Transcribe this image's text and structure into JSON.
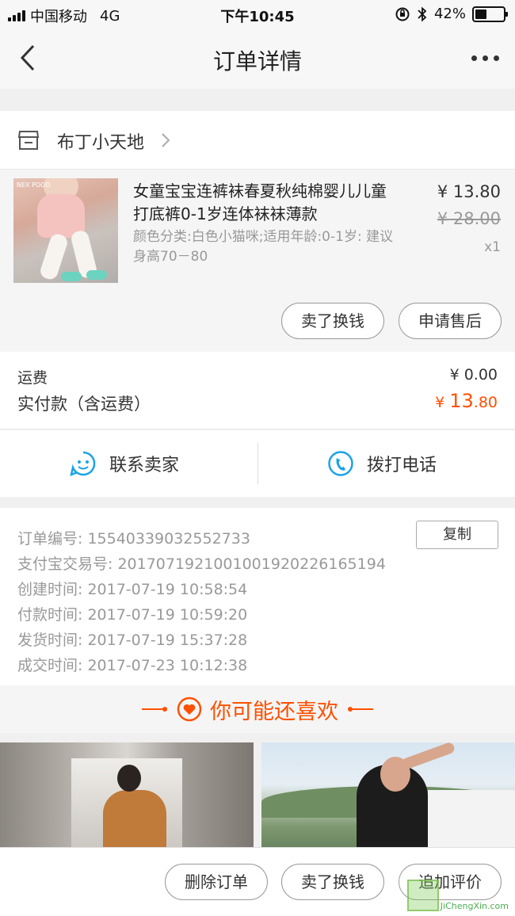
{
  "status_bar": {
    "carrier": "中国移动",
    "network": "4G",
    "time": "下午10:45",
    "battery_pct": "42%",
    "battery_level": 0.42
  },
  "nav": {
    "title": "订单详情"
  },
  "shop": {
    "name": "布丁小天地"
  },
  "product": {
    "thumb_tag": "NEX POOD",
    "title": "女童宝宝连裤袜春夏秋纯棉婴儿儿童打底裤0-1岁连体袜袜薄款",
    "spec": "颜色分类:白色小猫咪;适用年龄:0-1岁: 建议身高70－80",
    "price": "¥ 13.80",
    "original_price": "¥ 28.00",
    "quantity": "x1"
  },
  "product_actions": {
    "sell": "卖了换钱",
    "after_sale": "申请售后"
  },
  "fees": {
    "shipping_label": "运费",
    "shipping_value": "¥ 0.00",
    "paid_label": "实付款（含运费）",
    "paid_symbol": "¥ ",
    "paid_int": "13",
    "paid_dec": ".80"
  },
  "contact": {
    "seller": "联系卖家",
    "call": "拨打电话"
  },
  "order_info": {
    "order_no": "订单编号:  15540339032552733",
    "alipay_no": "支付宝交易号:  2017071921001001920226165194",
    "created": "创建时间:  2017-07-19 10:58:54",
    "paid": "付款时间:  2017-07-19 10:59:20",
    "shipped": "发货时间:  2017-07-19 15:37:28",
    "completed": "成交时间:  2017-07-23 10:12:38",
    "copy": "复制"
  },
  "recommend": {
    "title": "你可能还喜欢"
  },
  "bottom_actions": {
    "delete": "删除订单",
    "sell": "卖了换钱",
    "review": "追加评价"
  },
  "watermark": {
    "text": "JiChengXin.com"
  },
  "colors": {
    "accent": "#ff5000",
    "contact_icon": "#1aa3e8"
  }
}
